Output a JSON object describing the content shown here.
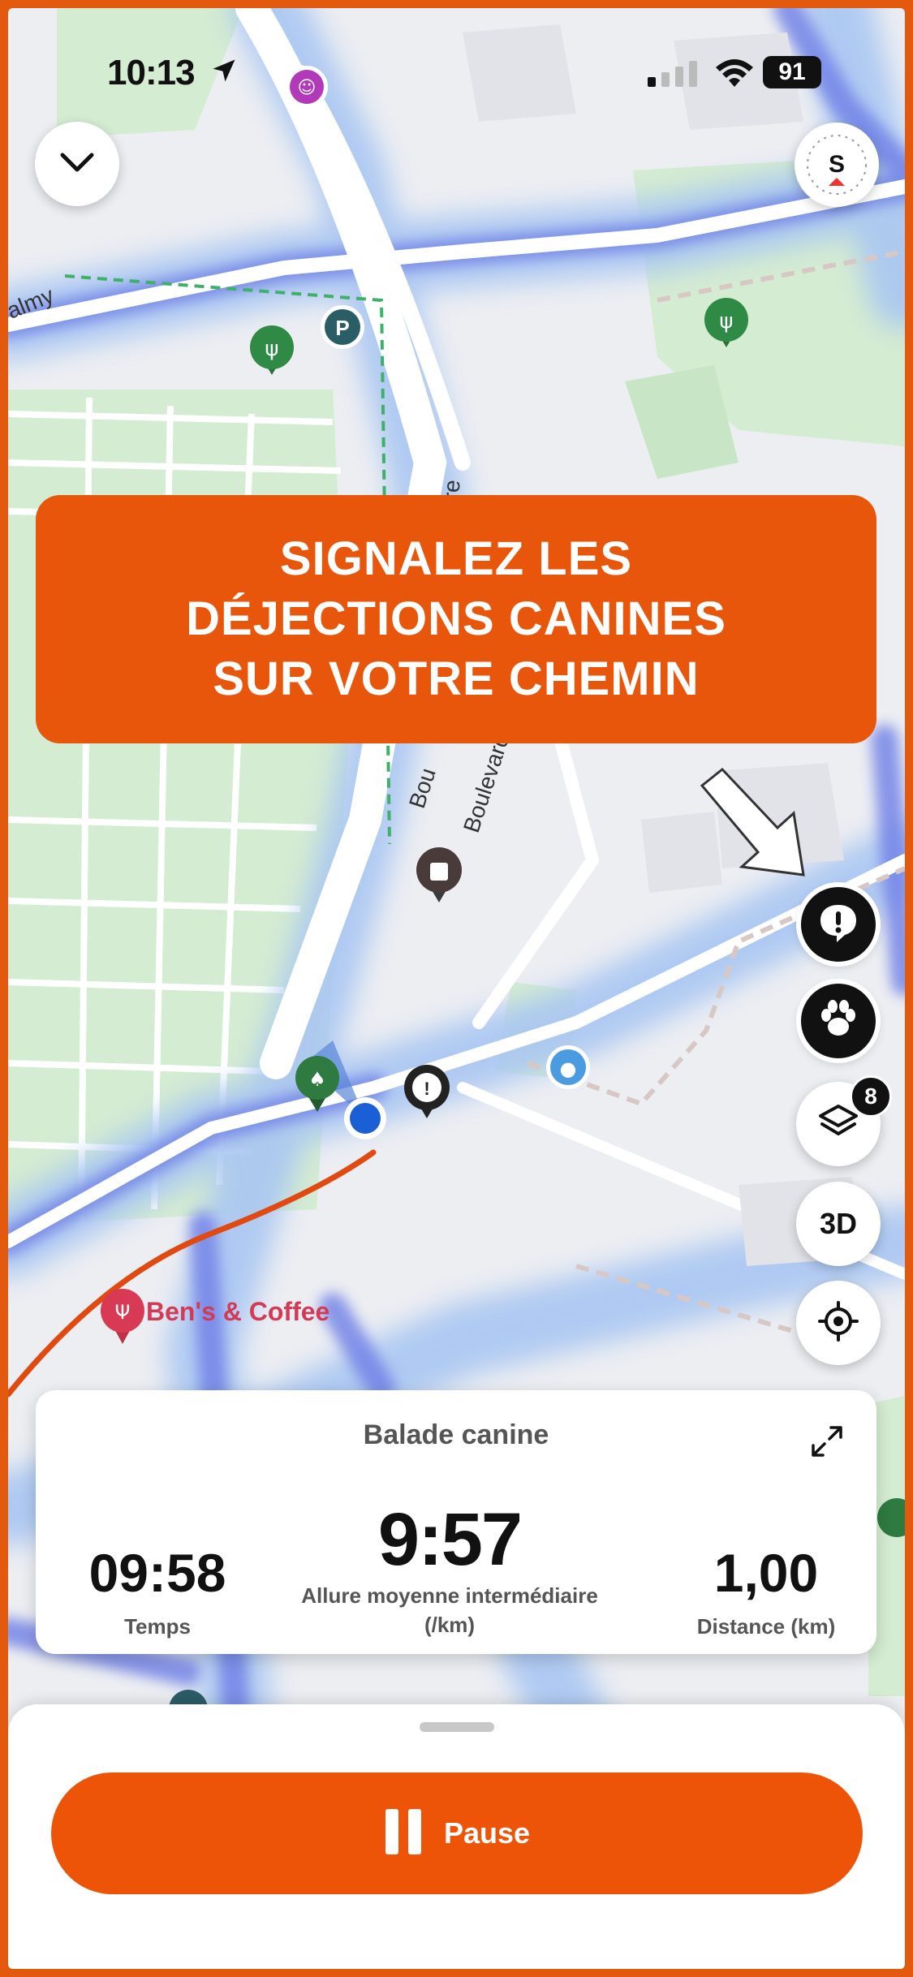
{
  "status_bar": {
    "time": "10:13",
    "battery": "91"
  },
  "compass": {
    "label": "S"
  },
  "map_labels": {
    "street_1": "Boulevard de Pesa",
    "street_2": "Bou",
    "street_3": "re",
    "street_4": "almy",
    "poi_restaurant": "Ben's & Coffee"
  },
  "banner": {
    "lines": [
      "SIGNALEZ LES",
      "DÉJECTIONS CANINES",
      "SUR VOTRE CHEMIN"
    ]
  },
  "side_controls": {
    "layers_badge": "8",
    "mode_3d": "3D"
  },
  "stats_card": {
    "title": "Balade canine",
    "time_value": "09:58",
    "time_label": "Temps",
    "pace_value": "9:57",
    "pace_label_line1": "Allure moyenne intermédiaire",
    "pace_label_line2": "(/km)",
    "distance_value": "1,00",
    "distance_label": "Distance (km)"
  },
  "bottom_sheet": {
    "pause_label": "Pause"
  },
  "colors": {
    "accent": "#e8560c",
    "route": "#e04a10",
    "location": "#1a5fd6"
  }
}
